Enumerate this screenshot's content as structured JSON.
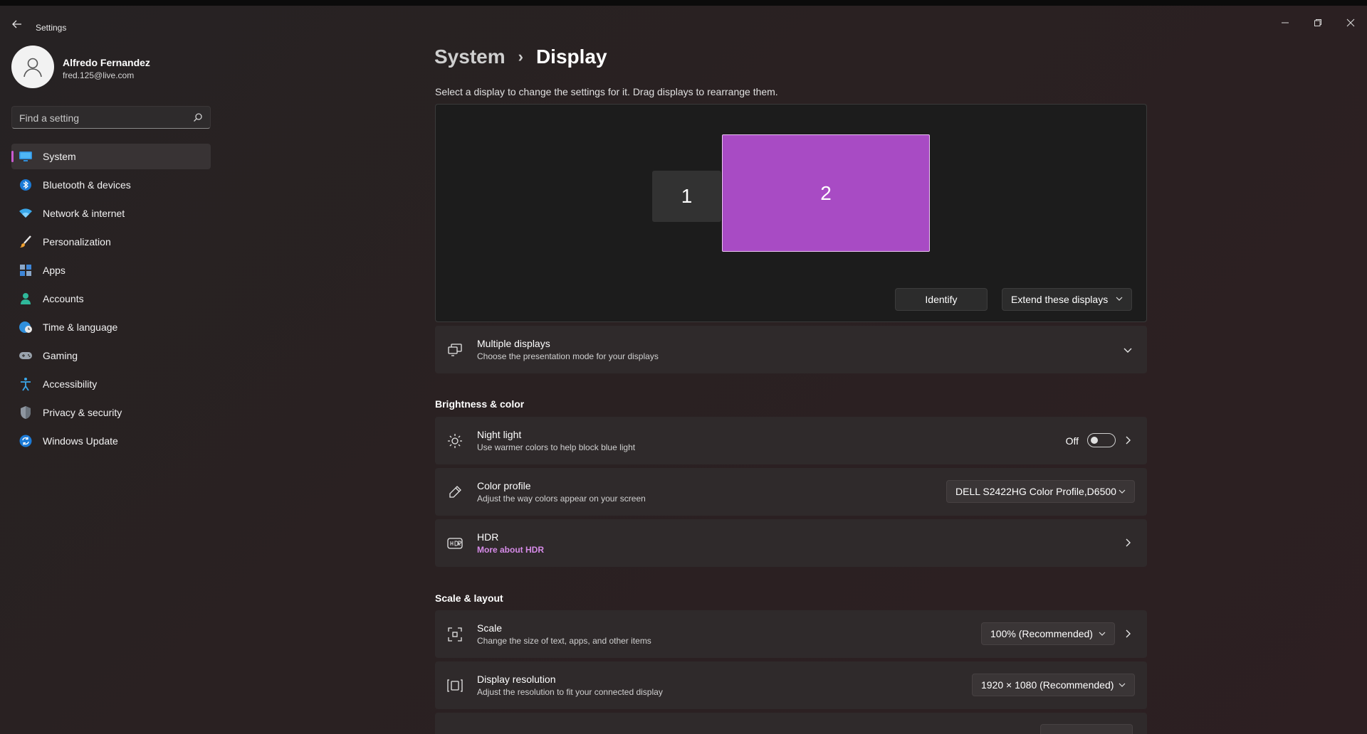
{
  "window": {
    "title": "Settings",
    "controls": [
      "minimize",
      "restore",
      "close"
    ]
  },
  "profile": {
    "name": "Alfredo Fernandez",
    "email": "fred.125@live.com"
  },
  "search": {
    "placeholder": "Find a setting"
  },
  "sidebar": {
    "items": [
      {
        "label": "System",
        "icon": "monitor-icon",
        "active": true
      },
      {
        "label": "Bluetooth & devices",
        "icon": "bluetooth-icon"
      },
      {
        "label": "Network & internet",
        "icon": "wifi-icon"
      },
      {
        "label": "Personalization",
        "icon": "brush-icon"
      },
      {
        "label": "Apps",
        "icon": "apps-icon"
      },
      {
        "label": "Accounts",
        "icon": "person-icon"
      },
      {
        "label": "Time & language",
        "icon": "globe-clock-icon"
      },
      {
        "label": "Gaming",
        "icon": "gamepad-icon"
      },
      {
        "label": "Accessibility",
        "icon": "accessibility-icon"
      },
      {
        "label": "Privacy & security",
        "icon": "shield-icon"
      },
      {
        "label": "Windows Update",
        "icon": "update-icon"
      }
    ]
  },
  "breadcrumb": {
    "parent": "System",
    "separator": "›",
    "current": "Display"
  },
  "arrangement": {
    "hint": "Select a display to change the settings for it. Drag displays to rearrange them.",
    "monitors": [
      "1",
      "2"
    ],
    "selected_monitor": "2",
    "identify_label": "Identify",
    "mode_label": "Extend these displays"
  },
  "multiple_displays": {
    "title": "Multiple displays",
    "subtitle": "Choose the presentation mode for your displays"
  },
  "brightness_color": {
    "section": "Brightness & color",
    "night_light": {
      "title": "Night light",
      "subtitle": "Use warmer colors to help block blue light",
      "state": "Off"
    },
    "color_profile": {
      "title": "Color profile",
      "subtitle": "Adjust the way colors appear on your screen",
      "value": "DELL S2422HG Color Profile,D6500"
    },
    "hdr": {
      "title": "HDR",
      "link": "More about HDR"
    }
  },
  "scale_layout": {
    "section": "Scale & layout",
    "scale": {
      "title": "Scale",
      "subtitle": "Change the size of text, apps, and other items",
      "value": "100% (Recommended)"
    },
    "resolution": {
      "title": "Display resolution",
      "subtitle": "Adjust the resolution to fit your connected display",
      "value": "1920 × 1080 (Recommended)"
    }
  },
  "colors": {
    "accent": "#a84bc4",
    "link": "#d68be8",
    "card": "#2f2a2b",
    "canvas": "#1c1c1c"
  }
}
